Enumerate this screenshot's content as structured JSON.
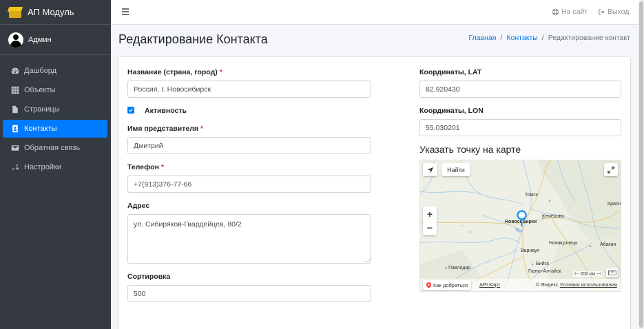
{
  "sidebar": {
    "brand": "АП Модуль",
    "user": "Админ",
    "items": [
      {
        "label": "Дашборд",
        "icon": "tachometer-icon"
      },
      {
        "label": "Объекты",
        "icon": "grid-icon"
      },
      {
        "label": "Страницы",
        "icon": "file-icon"
      },
      {
        "label": "Контакты",
        "icon": "address-book-icon",
        "active": true
      },
      {
        "label": "Обратная связь",
        "icon": "envelope-icon"
      },
      {
        "label": "Настройки",
        "icon": "tools-icon"
      }
    ]
  },
  "topbar": {
    "site_link": "На сайт",
    "logout": "Выход"
  },
  "page": {
    "title": "Редактирование Контакта",
    "breadcrumb": {
      "home": "Главная",
      "contacts": "Контакты",
      "current": "Редактирование контакт"
    }
  },
  "form": {
    "name": {
      "label": "Название (страна, город)",
      "value": "Россия, г. Новосибирск",
      "required": true
    },
    "active": {
      "label": "Активность",
      "checked": true
    },
    "representative": {
      "label": "Имя представителя",
      "value": "Дмитрий",
      "required": true
    },
    "phone": {
      "label": "Телефон",
      "value": "+7(913)376-77-66",
      "required": true
    },
    "address": {
      "label": "Адрес",
      "value": "ул. Сибиряков-Гвардейцев, 80/2"
    },
    "sort": {
      "label": "Сортировка",
      "value": "500"
    },
    "lat": {
      "label": "Координаты, LAT",
      "value": "82.920430"
    },
    "lon": {
      "label": "Координаты, LON",
      "value": "55.030201"
    },
    "required_mark": "*"
  },
  "map": {
    "title": "Указать точку на карте",
    "find_button": "Найти",
    "zoom_in": "+",
    "zoom_out": "−",
    "route_button": "Как добраться",
    "api_link": "API Карт",
    "copyright": "© Яндекс",
    "terms_link": "Условия использования",
    "scale": "200 км",
    "cities": {
      "tomsk": "Томск",
      "krasno": "Красн",
      "novosibirsk": "Новосибирск",
      "kemerovo": "Кемерово",
      "novokuznetsk": "Новокузнецк",
      "abakan": "Абакан",
      "barnaul": "Барнаул",
      "biysk": "Бийск",
      "pavlodar": "Павлодар",
      "gorno": "Горно-Алтайск"
    },
    "colors": {
      "water": "#a8c8e8",
      "roads": "#e6c87a",
      "pin": "#1e98ff"
    }
  }
}
